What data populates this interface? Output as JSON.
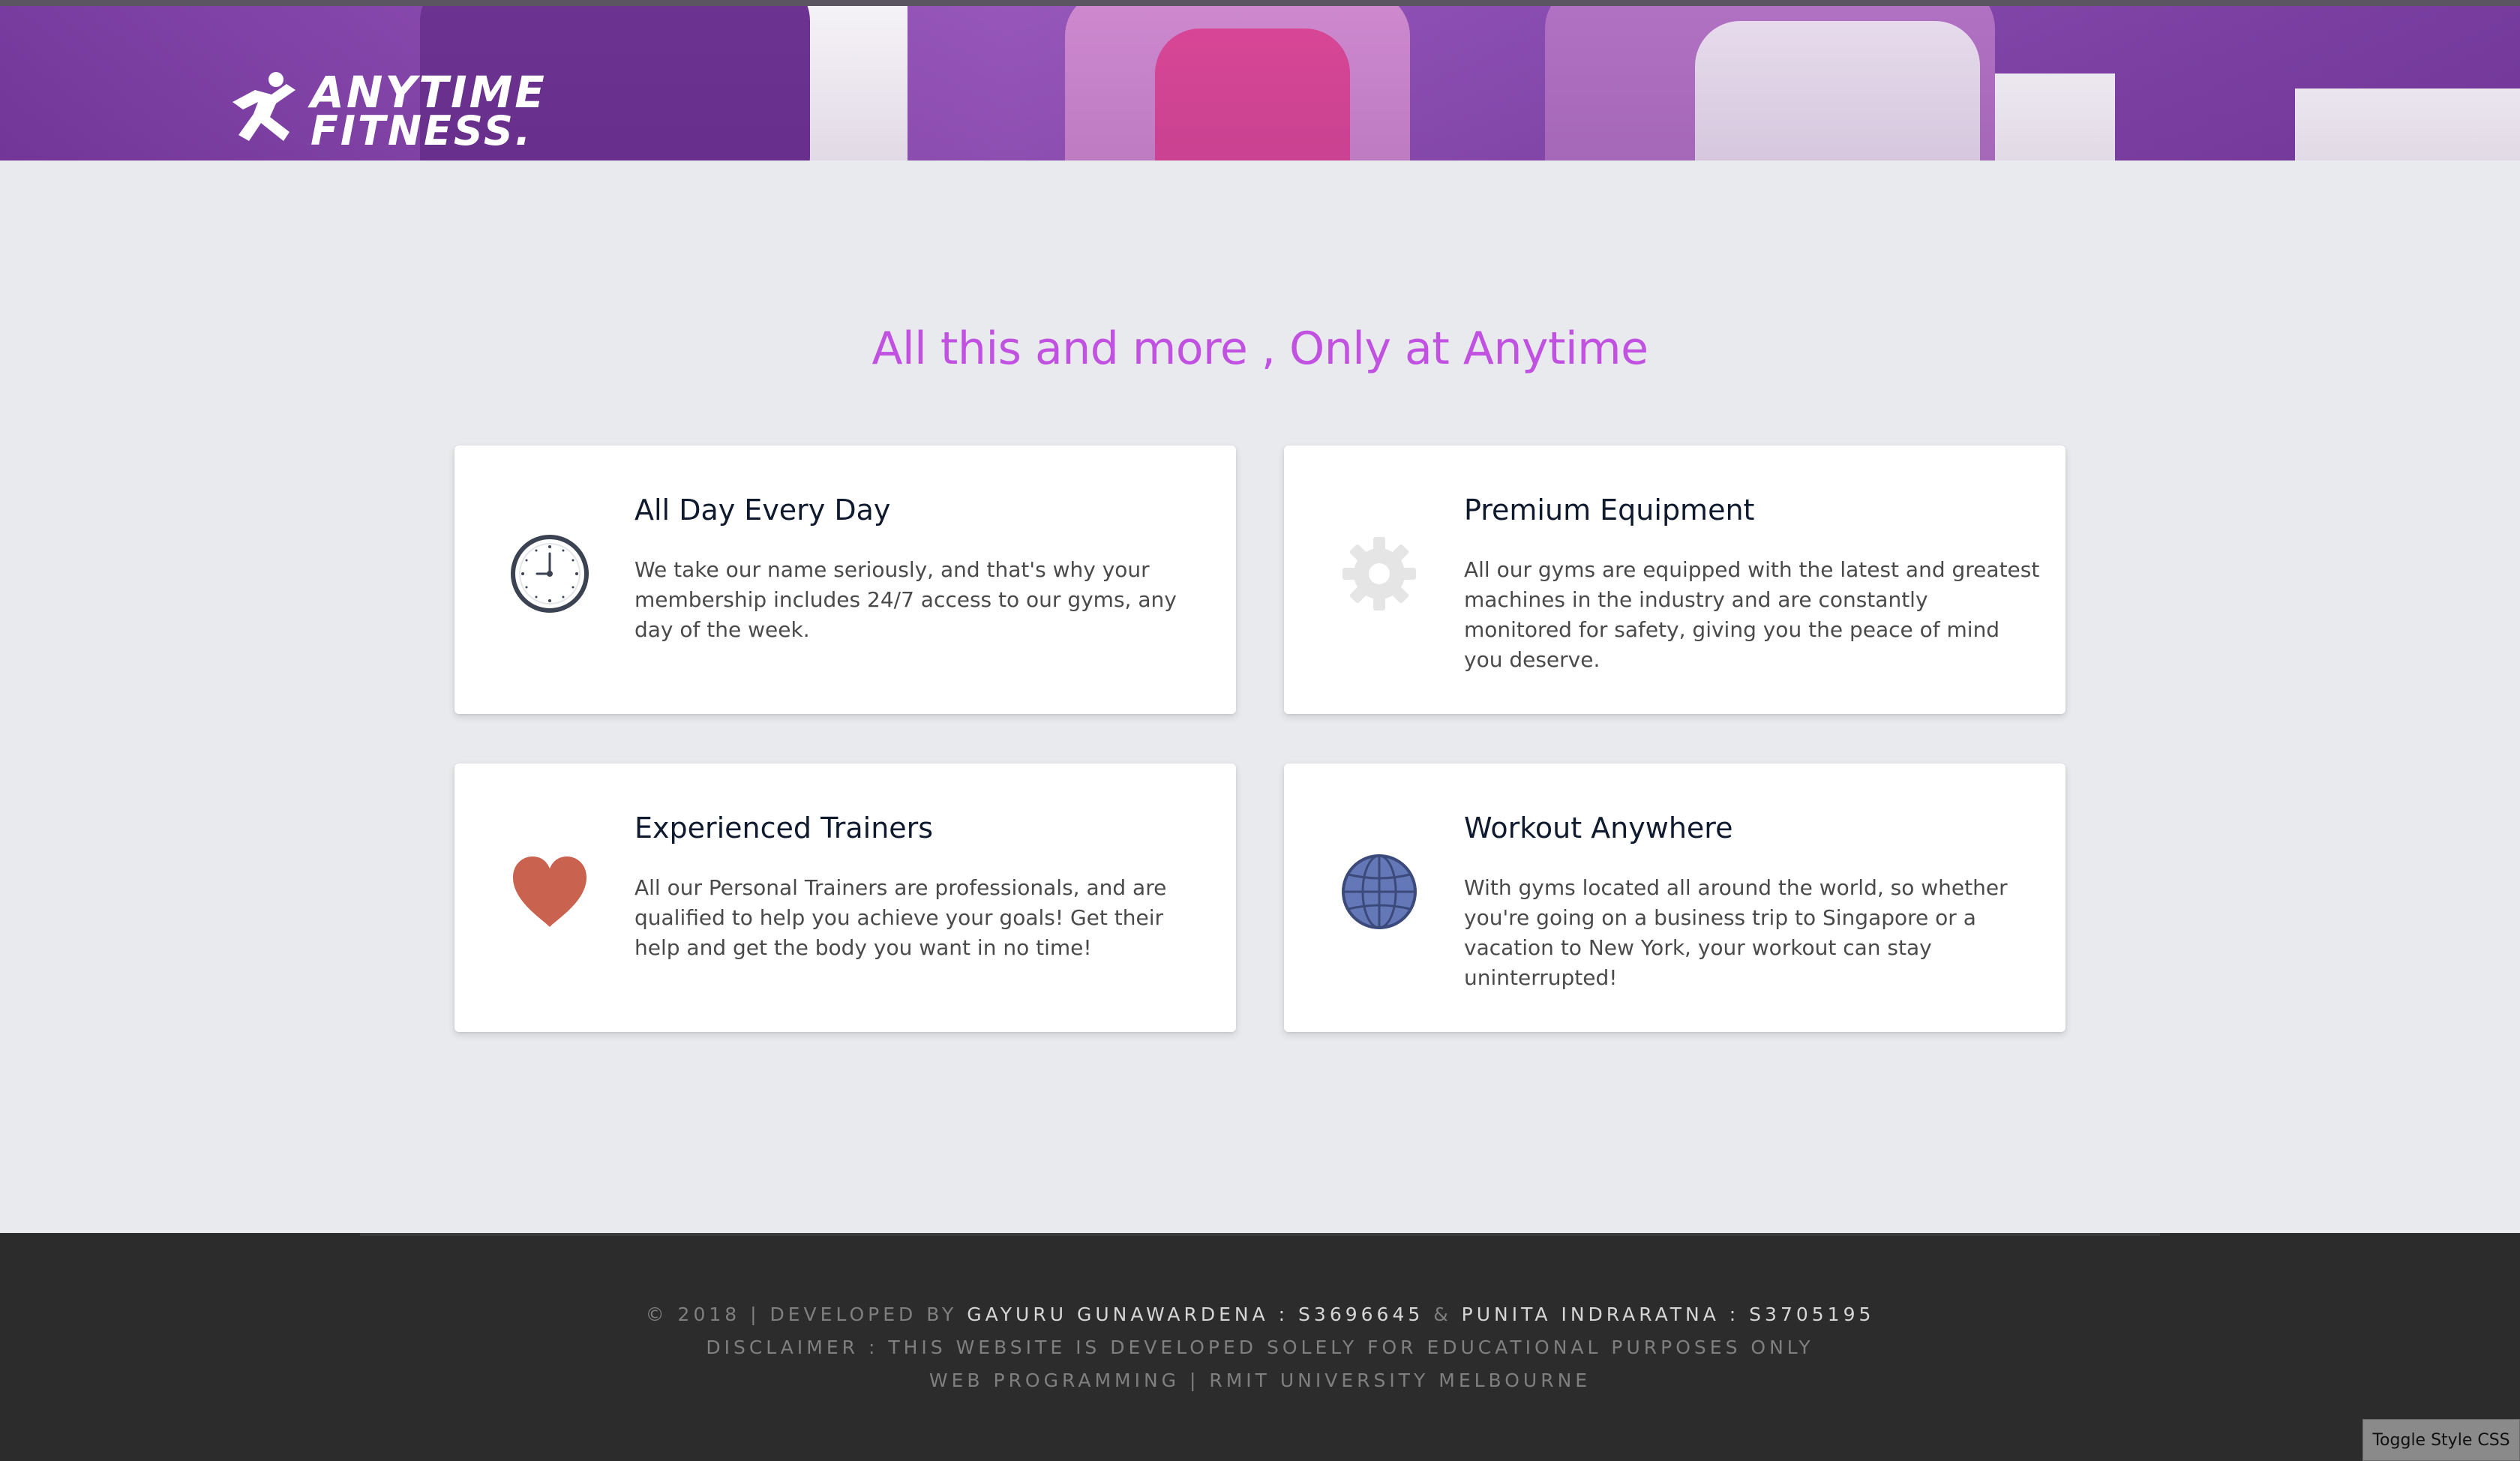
{
  "brand": {
    "logo_line1": "ANYTIME",
    "logo_line2": "FITNESS",
    "logo_dot": ".",
    "color_purple": "#9b5bbf"
  },
  "main": {
    "heading": "All this and more , Only at Anytime",
    "heading_color": "#c151e0",
    "features": [
      {
        "title": "All Day Every Day",
        "text": "We take our name seriously, and that's why your membership includes 24/7 access to our gyms, any day of the week.",
        "icon": "clock-icon"
      },
      {
        "title": "Premium Equipment",
        "text": "All our gyms are equipped with the latest and greatest machines in the industry and are constantly monitored for safety, giving you the peace of mind you deserve.",
        "icon": "gear-icon"
      },
      {
        "title": "Experienced Trainers",
        "text": "All our Personal Trainers are professionals, and are qualified to help you achieve your goals! Get their help and get the body you want in no time!",
        "icon": "heart-icon"
      },
      {
        "title": "Workout Anywhere",
        "text": "With gyms located all around the world, so whether you're going on a business trip to Singapore or a vacation to New York, your workout can stay uninterrupted!",
        "icon": "globe-icon"
      }
    ]
  },
  "footer": {
    "prefix": "© 2018 | DEVELOPED BY ",
    "dev1": "GAYURU GUNAWARDENA : S3696645",
    "amp": " & ",
    "dev2": "PUNITA INDRARATNA : S3705195",
    "disclaimer": "DISCLAIMER : THIS WEBSITE IS DEVELOPED SOLELY FOR EDUCATIONAL PURPOSES ONLY",
    "course": "WEB PROGRAMMING | RMIT UNIVERSITY MELBOURNE",
    "toggle_label": "Toggle Style CSS"
  }
}
